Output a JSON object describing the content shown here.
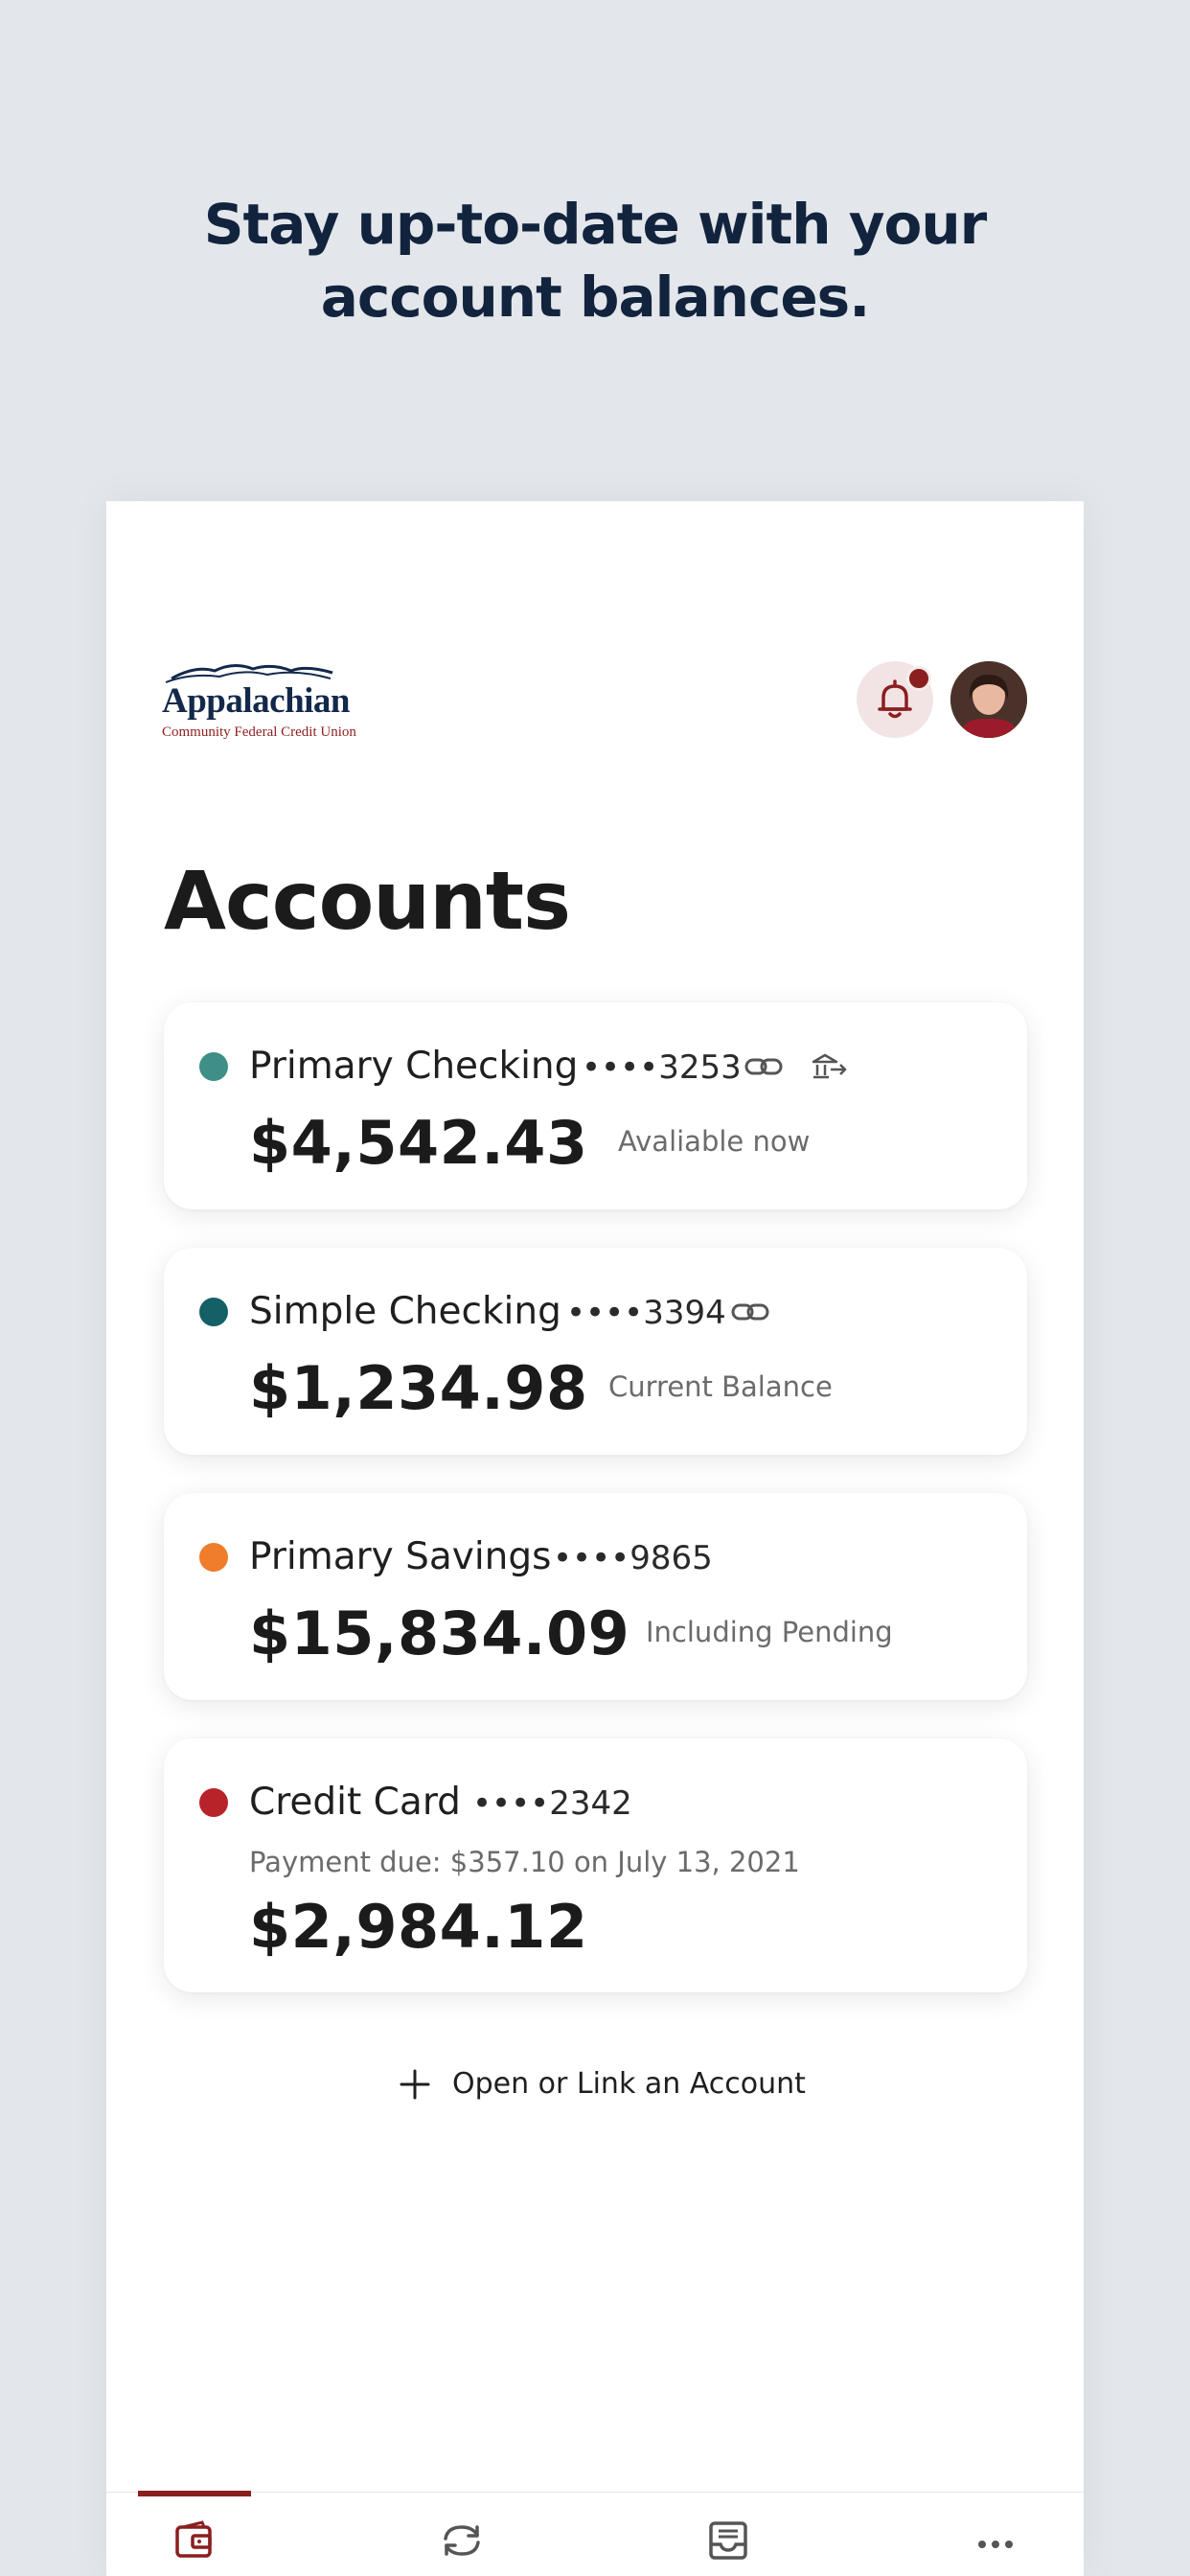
{
  "promo": {
    "headline_line1": "Stay up-to-date with your",
    "headline_line2": "account balances."
  },
  "header": {
    "logo_name": "Appalachian",
    "logo_subtitle": "Community Federal Credit Union",
    "notification_icon": "bell-icon",
    "has_unread_notifications": true
  },
  "page": {
    "title": "Accounts"
  },
  "accounts": [
    {
      "name": "Primary Checking",
      "masked_number": "••••3253",
      "balance": "$4,542.43",
      "balance_note": "Avaliable now",
      "dot_color": "#3e8f87",
      "icons": [
        "link-icon",
        "bank-transfer-icon"
      ]
    },
    {
      "name": "Simple Checking",
      "masked_number": "••••3394",
      "balance": "$1,234.98",
      "balance_note": "Current Balance",
      "dot_color": "#155f66",
      "icons": [
        "link-icon"
      ]
    },
    {
      "name": "Primary Savings",
      "masked_number": "••••9865",
      "balance": "$15,834.09",
      "balance_note": "Including Pending",
      "dot_color": "#ef7d2c",
      "icons": []
    },
    {
      "name": "Credit Card",
      "masked_number": "••••2342",
      "payment_due": "Payment due: $357.10 on July 13, 2021",
      "balance": "$2,984.12",
      "dot_color": "#b8232a",
      "icons": []
    }
  ],
  "actions": {
    "open_link_label": "Open or Link an Account"
  },
  "bottom_nav": {
    "items": [
      {
        "icon": "wallet-icon",
        "active": true
      },
      {
        "icon": "transfer-icon",
        "active": false
      },
      {
        "icon": "inbox-icon",
        "active": false
      },
      {
        "icon": "more-icon",
        "active": false
      }
    ]
  },
  "colors": {
    "brand": "#8b1e1e",
    "headline": "#12233d",
    "background": "#e3e7eb"
  }
}
